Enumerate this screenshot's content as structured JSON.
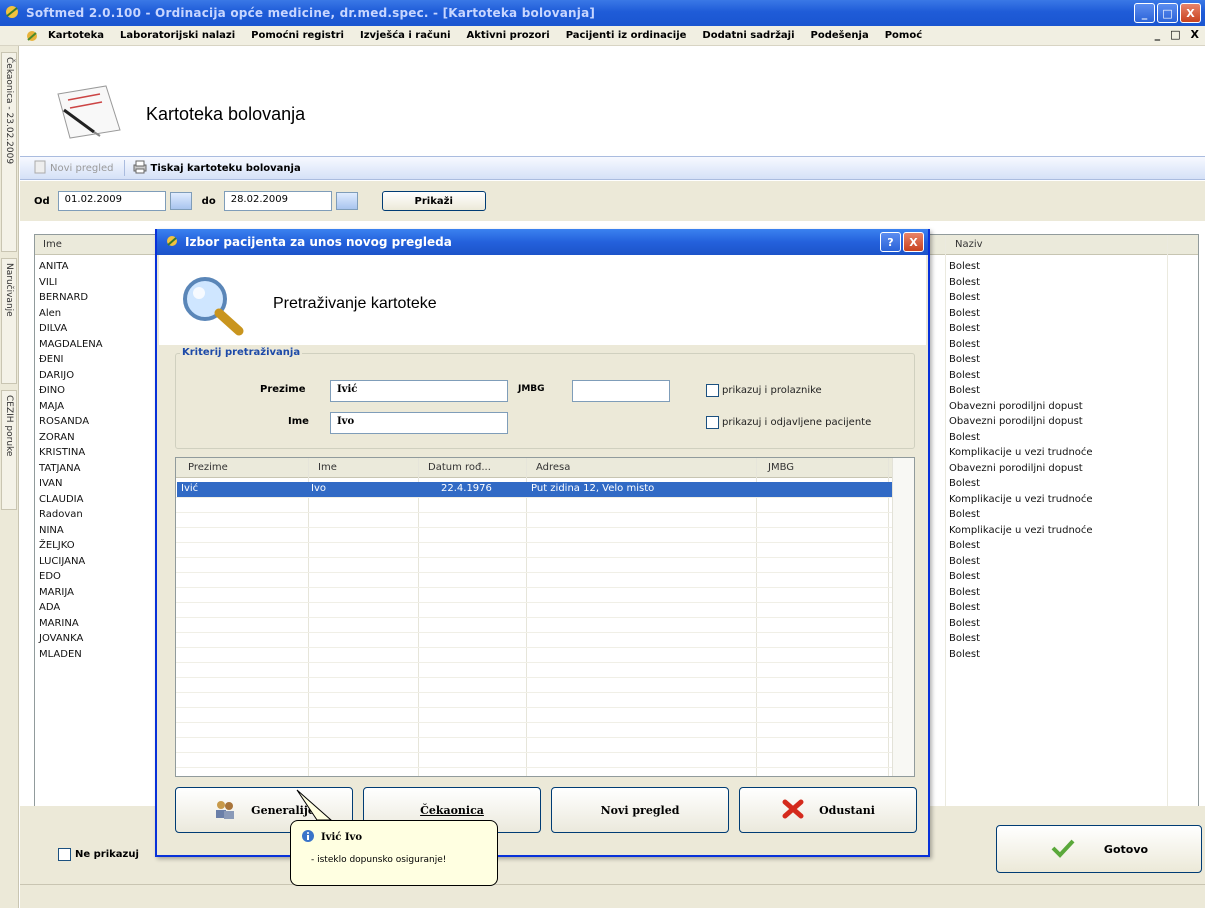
{
  "window": {
    "title": "Softmed 2.0.100 - Ordinacija opće medicine, dr.med.spec. - [Kartoteka bolovanja]",
    "min": "_",
    "max": "□",
    "close": "X"
  },
  "menu": [
    "Kartoteka",
    "Laboratorijski nalazi",
    "Pomoćni registri",
    "Izvješća i računi",
    "Aktivni prozori",
    "Pacijenti iz ordinacije",
    "Dodatni sadržaji",
    "Podešenja",
    "Pomoć"
  ],
  "mdi": {
    "min": "_",
    "restore": "□",
    "close": "X"
  },
  "side_tabs": [
    "Čekaonica - 23.02.2009",
    "Naručivanje",
    "CEZIH poruke"
  ],
  "page_title": "Kartoteka bolovanja",
  "toolbar": {
    "new_exam": "Novi pregled",
    "print": "Tiskaj kartoteku bolovanja"
  },
  "filter": {
    "from_label": "Od",
    "from_value": "01.02.2009",
    "to_label": "do",
    "to_value": "28.02.2009",
    "show_button": "Prikaži"
  },
  "grid": {
    "col_name": "Ime",
    "col_naziv": "Naziv",
    "names": [
      "ANITA",
      "VILI",
      "BERNARD",
      "Alen",
      "DILVA",
      "MAGDALENA",
      "ĐENI",
      "DARIJO",
      "ĐINO",
      "MAJA",
      "ROSANDA",
      "ZORAN",
      "KRISTINA",
      "TATJANA",
      "IVAN",
      "CLAUDIA",
      "Radovan",
      "NINA",
      "ŽELJKO",
      "LUCIJANA",
      "EDO",
      "MARIJA",
      "ADA",
      "MARINA",
      "JOVANKA",
      "MLADEN"
    ],
    "naziv": [
      "Bolest",
      "Bolest",
      "Bolest",
      "Bolest",
      "Bolest",
      "Bolest",
      "Bolest",
      "Bolest",
      "Bolest",
      "Obavezni porodiljni dopust",
      "Obavezni porodiljni dopust",
      "Bolest",
      "Komplikacije u vezi trudnoće",
      "Obavezni porodiljni dopust",
      "Bolest",
      "Komplikacije u vezi trudnoće",
      "Bolest",
      "Komplikacije u vezi trudnoće",
      "Bolest",
      "Bolest",
      "Bolest",
      "Bolest",
      "Bolest",
      "Bolest",
      "Bolest",
      "Bolest"
    ]
  },
  "bottom": {
    "checkbox_label": "Ne prikazuj",
    "done_button": "Gotovo"
  },
  "dialog": {
    "title": "Izbor pacijenta za unos novog pregleda",
    "help": "?",
    "close": "X",
    "header": "Pretraživanje kartoteke",
    "criteria_legend": "Kriterij pretraživanja",
    "prezime_label": "Prezime",
    "prezime_value": "Ivić",
    "ime_label": "Ime",
    "ime_value": "Ivo",
    "jmbg_label": "JMBG",
    "jmbg_value": "",
    "chk_prolaznike": "prikazuj i prolaznike",
    "chk_odjavljene": "prikazuj i odjavljene pacijente",
    "columns": [
      "Prezime",
      "Ime",
      "Datum rođ...",
      "Adresa",
      "JMBG"
    ],
    "rows": [
      {
        "prezime": "Ivić",
        "ime": "Ivo",
        "datum": "22.4.1976",
        "adresa": "Put zidina 12, Velo misto",
        "jmbg": ""
      }
    ],
    "buttons": {
      "generalije": "Generalije",
      "cekaonica": "Čekaonica",
      "novi_pregled": "Novi pregled",
      "odustani": "Odustani"
    }
  },
  "tooltip": {
    "name": "Ivić Ivo",
    "message": "- isteklo dopunsko osiguranje!"
  }
}
